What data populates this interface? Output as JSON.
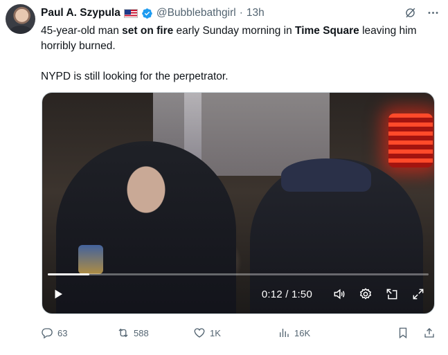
{
  "author": {
    "display_name": "Paul A. Szypula",
    "handle": "@Bubblebathgirl",
    "separator": "·",
    "time": "13h",
    "flag_icon": "us-flag-icon",
    "verified_icon": "verified-badge-icon",
    "verified_color": "#1d9bf0"
  },
  "post": {
    "line1_a": "45-year-old man ",
    "line1_b": "set on fire",
    "line1_c": " early Sunday morning in ",
    "line1_d": "Time Square",
    "line1_e": " leaving him horribly burned.",
    "line2": "NYPD is still looking for the perpetrator."
  },
  "video": {
    "current_time": "0:12",
    "duration": "1:50",
    "time_separator": " / ",
    "progress_fraction": 0.109,
    "controls": [
      "play-icon",
      "volume-icon",
      "settings-icon",
      "dock-icon",
      "fullscreen-icon"
    ]
  },
  "actions": {
    "replies": "63",
    "reposts": "588",
    "likes": "1K",
    "views": "16K",
    "muted_color": "#536471"
  }
}
